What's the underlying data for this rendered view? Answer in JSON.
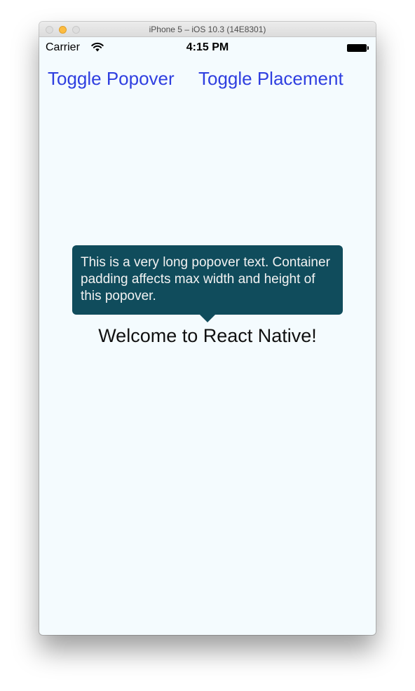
{
  "window": {
    "title": "iPhone 5 – iOS 10.3 (14E8301)"
  },
  "status_bar": {
    "carrier": "Carrier",
    "time": "4:15 PM",
    "wifi_icon": "wifi-icon",
    "battery_icon": "battery-icon"
  },
  "buttons": {
    "toggle_popover": "Toggle Popover",
    "toggle_placement": "Toggle Placement"
  },
  "popover": {
    "text": "This is a very long popover text. Container padding affects max width and height of this popover."
  },
  "main": {
    "welcome": "Welcome to React Native!"
  },
  "colors": {
    "button_text": "#2f3fe0",
    "popover_background": "#104c5c",
    "screen_background": "#f4fbfe"
  }
}
